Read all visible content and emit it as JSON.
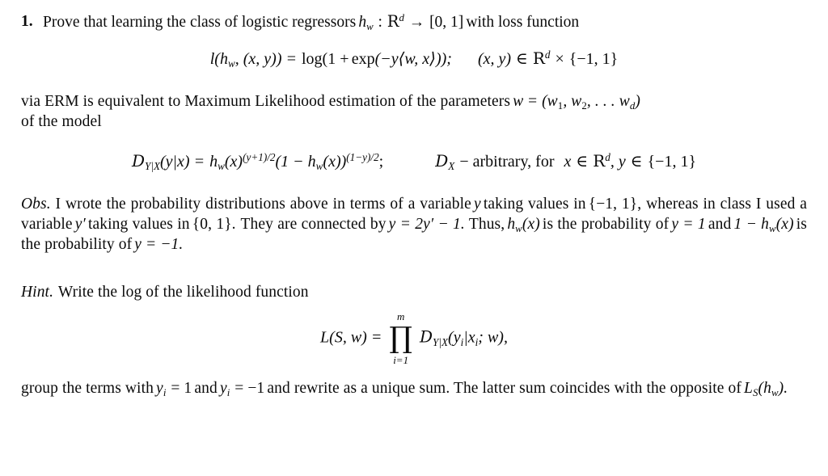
{
  "document": {
    "type": "latex-math-exercise",
    "background_color": "#ffffff",
    "text_color": "#0a0a0a"
  },
  "problem": {
    "number": "1.",
    "statement_part_1": "Prove that learning the class of logistic regressors",
    "statement_part_2": "with loss function",
    "h_symbol": "h",
    "h_subscript": "w",
    "colon": ":",
    "domain_blackboard": "R",
    "domain_exponent": "d",
    "arrow": "→",
    "codomain": "[0, 1]"
  },
  "loss_equation": {
    "lhs": "l(h",
    "lhs_sub": "w",
    "lhs_args": ", (x, y)) =",
    "log": "log",
    "open": "(1 +",
    "exp": "exp",
    "inner": "(−y⟨w, x⟩));",
    "condition_pair": "(x, y)",
    "in_symbol": "∈",
    "blackboard_r": "R",
    "exponent_d": "d",
    "times": "×",
    "set": "{−1, 1}"
  },
  "erm_text": {
    "line1_a": "via ERM is equivalent to Maximum Likelihood estimation of the parameters",
    "w_symbol": "w",
    "equals": "=",
    "w_vector": "(w",
    "w_sub_1": "1",
    "w_comma_1": ", w",
    "w_sub_2": "2",
    "w_dots": ", . . . w",
    "w_sub_d": "d",
    "w_close": ")",
    "line2": "of the model"
  },
  "distribution_equation": {
    "cal_d": "D",
    "d_subscript": "Y|X",
    "args": "(y|x) =",
    "h_symbol": "h",
    "h_sub": "w",
    "h_arg": "(x)",
    "exp_1": "(y+1)/2",
    "one_minus": "(1 − h",
    "one_minus_sub": "w",
    "one_minus_arg": "(x))",
    "exp_2": "(1−y)/2",
    "semicolon": ";",
    "d_x_cal": "D",
    "d_x_sub": "X",
    "arbitrary": "− arbitrary, for",
    "x_var": "x",
    "in_symbol": "∈",
    "blackboard_r": "R",
    "exponent_d": "d",
    "comma_y": ", y",
    "in_symbol_2": "∈",
    "set": "{−1, 1}"
  },
  "observation": {
    "label": "Obs.",
    "line1_a": "I wrote the probability distributions above in terms of a variable",
    "var_y": "y",
    "line1_b": "taking values in",
    "set_1": "{−1, 1},",
    "line2_a": "whereas in class I used a variable",
    "var_y_prime": "y′",
    "line2_b": "taking values in",
    "set_2": "{0, 1}.",
    "line2_c": "They are connected by",
    "relation": "y = 2y′ − 1.",
    "line3_a": "Thus,",
    "h_sym": "h",
    "h_sub": "w",
    "h_arg": "(x)",
    "line3_b": "is the probability of",
    "y_eq_1": "y = 1",
    "line3_c": "and",
    "one_minus_h": "1 − h",
    "one_minus_h_sub": "w",
    "one_minus_h_arg": "(x)",
    "line3_d": "is the probability of",
    "y_eq_neg1": "y = −1."
  },
  "hint": {
    "label": "Hint.",
    "text": "Write the log of the likelihood function"
  },
  "likelihood_equation": {
    "lhs_l": "L",
    "lhs_args": "(S, w) =",
    "product_glyph": "∏",
    "product_upper": "m",
    "product_lower": "i=1",
    "cal_d": "D",
    "d_subscript": "Y|X",
    "args": "(y",
    "sub_i_1": "i",
    "bar": "|x",
    "sub_i_2": "i",
    "tail": "; w),"
  },
  "closing": {
    "line1_a": "group the terms with",
    "y_i_1": "y",
    "y_i_1_sub": "i",
    "y_i_1_val": "= 1",
    "line1_b": "and",
    "y_i_2": "y",
    "y_i_2_sub": "i",
    "y_i_2_val": "= −1",
    "line1_c": "and rewrite as a unique sum.  The latter sum coincides",
    "line2_a": "with the opposite of",
    "l_sym": "L",
    "l_sub": "S",
    "l_arg_open": "(h",
    "l_arg_sub": "w",
    "l_arg_close": ")."
  }
}
